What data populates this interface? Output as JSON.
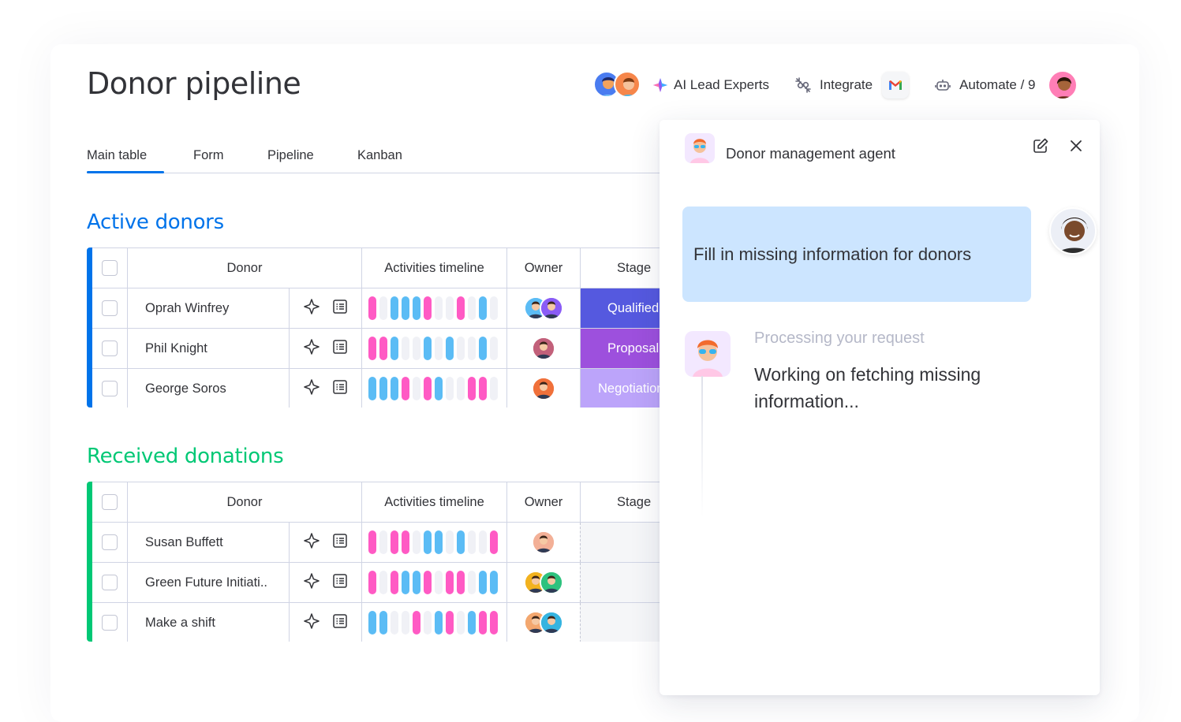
{
  "page": {
    "title": "Donor pipeline"
  },
  "topbar": {
    "ai_lead_label": "AI Lead Experts",
    "integrate_label": "Integrate",
    "automate_label": "Automate / 9"
  },
  "tabs": [
    {
      "label": "Main table",
      "active": true
    },
    {
      "label": "Form",
      "active": false
    },
    {
      "label": "Pipeline",
      "active": false
    },
    {
      "label": "Kanban",
      "active": false
    }
  ],
  "groups": [
    {
      "title": "Active donors",
      "color": "#0073ea",
      "headers": {
        "donor": "Donor",
        "timeline": "Activities timeline",
        "owner": "Owner",
        "stage": "Stage"
      },
      "rows": [
        {
          "name": "Oprah Winfrey",
          "stage": "Qualified",
          "stage_color": "#5559df",
          "timeline": [
            "p",
            "g",
            "b",
            "b",
            "b",
            "p",
            "g",
            "g",
            "p",
            "g",
            "b",
            "g"
          ]
        },
        {
          "name": "Phil  Knight",
          "stage": "Proposal",
          "stage_color": "#9d50dd",
          "timeline": [
            "p",
            "p",
            "b",
            "g",
            "g",
            "b",
            "g",
            "b",
            "g",
            "g",
            "b",
            "g"
          ]
        },
        {
          "name": "George Soros",
          "stage": "Negotiation",
          "stage_color": "#bca4fa",
          "timeline": [
            "b",
            "b",
            "b",
            "p",
            "g",
            "p",
            "b",
            "g",
            "g",
            "p",
            "p",
            "g"
          ]
        }
      ]
    },
    {
      "title": "Received donations",
      "color": "#00c875",
      "headers": {
        "donor": "Donor",
        "timeline": "Activities timeline",
        "owner": "Owner",
        "stage": "Stage"
      },
      "rows": [
        {
          "name": "Susan Buffett",
          "timeline": [
            "p",
            "g",
            "p",
            "p",
            "g",
            "b",
            "b",
            "g",
            "b",
            "g",
            "g",
            "p"
          ]
        },
        {
          "name": "Green Future Initiati..",
          "timeline": [
            "p",
            "g",
            "p",
            "b",
            "b",
            "p",
            "g",
            "p",
            "p",
            "g",
            "b",
            "b"
          ]
        },
        {
          "name": "Make a shift",
          "timeline": [
            "b",
            "b",
            "g",
            "g",
            "p",
            "g",
            "b",
            "p",
            "g",
            "b",
            "p",
            "p"
          ]
        }
      ]
    }
  ],
  "agent_panel": {
    "title": "Donor management agent",
    "user_message": "Fill in missing information for donors",
    "status": "Processing your request",
    "response": "Working on fetching missing information..."
  },
  "colors": {
    "pink": "#ff5ac4",
    "blue": "#5bbcf5",
    "gray": "#f0f1f6",
    "accent": "#0073ea",
    "green": "#00c875"
  },
  "icons": [
    "sparkle-icon",
    "disconnect-plug-icon",
    "gmail-icon",
    "robot-icon",
    "star-outline-icon",
    "list-icon",
    "edit-icon",
    "close-icon"
  ]
}
